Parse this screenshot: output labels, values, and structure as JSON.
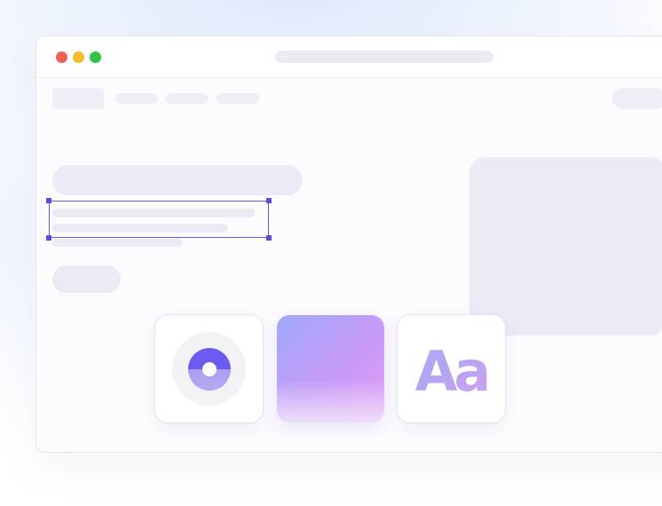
{
  "window": {
    "traffic_lights": {
      "close": "#ee5f57",
      "minimize": "#f6bb2e",
      "zoom": "#2ec544"
    }
  },
  "selection": {
    "color": "#6b5bd8"
  },
  "cards": {
    "typography": {
      "sample_text": "Aa"
    },
    "icons": [
      "donut-chart-icon",
      "gradient-swatch",
      "typography-icon"
    ]
  }
}
